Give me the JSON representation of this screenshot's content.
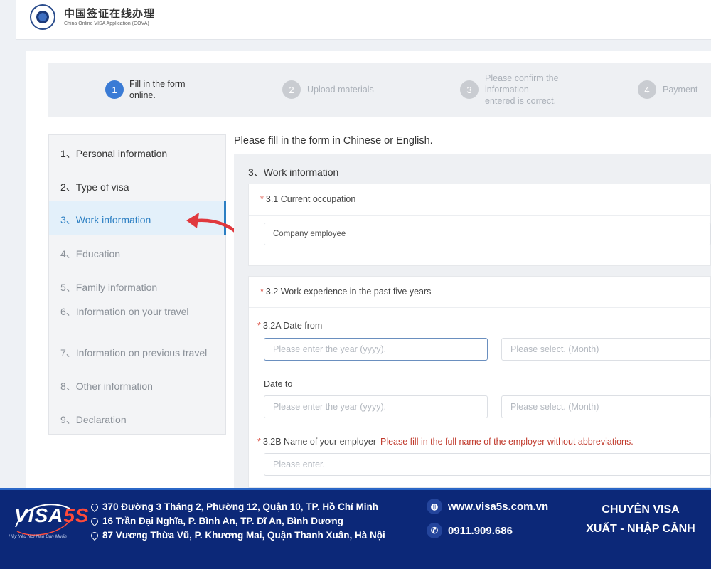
{
  "header": {
    "title": "中国签证在线办理",
    "subtitle": "China Online VISA Application (COVA)"
  },
  "steps": [
    {
      "number": "1",
      "label_line1": "Fill in the form",
      "label_line2": "online.",
      "label_line3": ""
    },
    {
      "number": "2",
      "label_line1": "Upload materials",
      "label_line2": "",
      "label_line3": ""
    },
    {
      "number": "3",
      "label_line1": "Please confirm the",
      "label_line2": "information",
      "label_line3": "entered is correct."
    },
    {
      "number": "4",
      "label_line1": "Payment",
      "label_line2": "",
      "label_line3": ""
    }
  ],
  "sidebar": {
    "items": [
      {
        "label": "1、Personal information"
      },
      {
        "label": "2、Type of visa"
      },
      {
        "label": "3、Work information"
      },
      {
        "label": "4、Education"
      },
      {
        "label": "5、Family information"
      },
      {
        "label": "6、Information on your travel"
      },
      {
        "label": "7、Information on previous travel"
      },
      {
        "label": "8、Other information"
      },
      {
        "label": "9、Declaration"
      }
    ],
    "active_index": 2
  },
  "form": {
    "intro": "Please fill in the form in Chinese or English.",
    "section_title": "3、Work information",
    "required_mark": "*",
    "q31": {
      "label": "3.1 Current occupation",
      "value": "Company employee"
    },
    "q32": {
      "label": "3.2 Work experience in the past five years",
      "date_from_label": "3.2A Date from",
      "date_to_label": "Date to",
      "year_placeholder": "Please enter the year (yyyy).",
      "month_placeholder": "Please select. (Month)",
      "employer_label": "3.2B Name of your employer",
      "employer_hint": "Please fill in the full name of the employer without abbreviations.",
      "employer_placeholder": "Please enter."
    }
  },
  "footer": {
    "brand_main": "VISA",
    "brand_accent": "5S",
    "slogan": "Hãy Yêu Nơi Nào Bạn Muốn",
    "addresses": [
      "370 Đường 3 Tháng 2, Phường 12, Quận 10, TP. Hồ Chí Minh",
      "16 Trần Đại Nghĩa, P. Bình An, TP. Dĩ An, Bình Dương",
      "87 Vương Thừa Vũ, P. Khương Mai, Quận Thanh Xuân, Hà Nội"
    ],
    "website": "www.visa5s.com.vn",
    "phone": "0911.909.686",
    "tagline_line1": "CHUYÊN VISA",
    "tagline_line2": "XUẤT - NHẬP CẢNH"
  },
  "colors": {
    "step_active": "#3a7bd5",
    "sidebar_active": "#2c7fc3",
    "required": "#d9473a",
    "footer_bg": "#0c2878",
    "arrow": "#e0393e"
  }
}
